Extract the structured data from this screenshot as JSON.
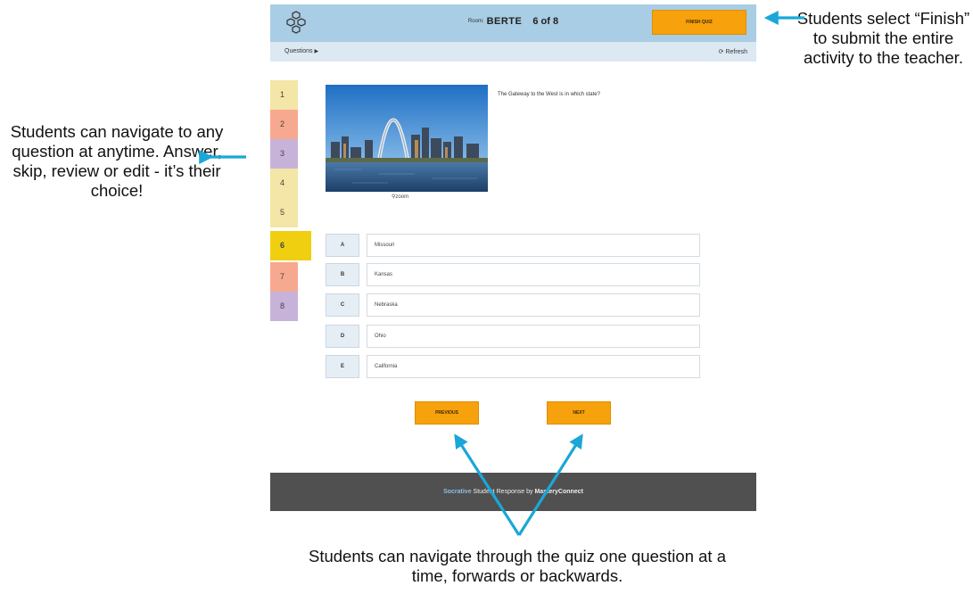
{
  "header": {
    "room_label": "Room:",
    "room_code": "BERTE",
    "progress": "6 of 8",
    "finish_label": "Finish Quiz",
    "logo_icon": "hexagon-cluster-logo-icon"
  },
  "subbar": {
    "questions_label": "Questions",
    "questions_icon": "play-triangle-icon",
    "refresh_label": "Refresh",
    "refresh_icon": "refresh-icon"
  },
  "question_nav": [
    {
      "number": "1",
      "color": "#f3e6a6"
    },
    {
      "number": "2",
      "color": "#f7a98f"
    },
    {
      "number": "3",
      "color": "#c7b3d9"
    },
    {
      "number": "4",
      "color": "#f3e6a6"
    },
    {
      "number": "5",
      "color": "#f3e6a6"
    },
    {
      "number": "6",
      "color": "#f0cf10",
      "current": true
    },
    {
      "number": "7",
      "color": "#f7a98f"
    },
    {
      "number": "8",
      "color": "#c7b3d9"
    }
  ],
  "question": {
    "text": "The Gateway to the West is in which state?",
    "zoom_label": "zoom",
    "zoom_icon": "magnifier-icon",
    "image": "gateway-arch-photo"
  },
  "choices": [
    {
      "letter": "A",
      "text": "Missouri"
    },
    {
      "letter": "B",
      "text": "Kansas"
    },
    {
      "letter": "C",
      "text": "Nebraska"
    },
    {
      "letter": "D",
      "text": "Ohio"
    },
    {
      "letter": "E",
      "text": "California"
    }
  ],
  "nav_buttons": {
    "previous_label": "Previous",
    "next_label": "Next"
  },
  "footer": {
    "brand": "Socrative",
    "text": " Student Response by ",
    "company": "MasteryConnect"
  },
  "annotations": {
    "left": "Students can navigate to any question at anytime.  Answer, skip, review or edit - it’s their choice!",
    "right": "Students select “Finish” to submit the entire activity to the teacher.",
    "bottom": "Students can navigate through the quiz one question at a time, forwards or backwards."
  },
  "colors": {
    "accent_orange": "#f7a10c",
    "header_blue": "#a9cde4",
    "subbar_blue": "#dce8f2",
    "footer_gray": "#505050",
    "arrow_cyan": "#1aa7d8"
  }
}
